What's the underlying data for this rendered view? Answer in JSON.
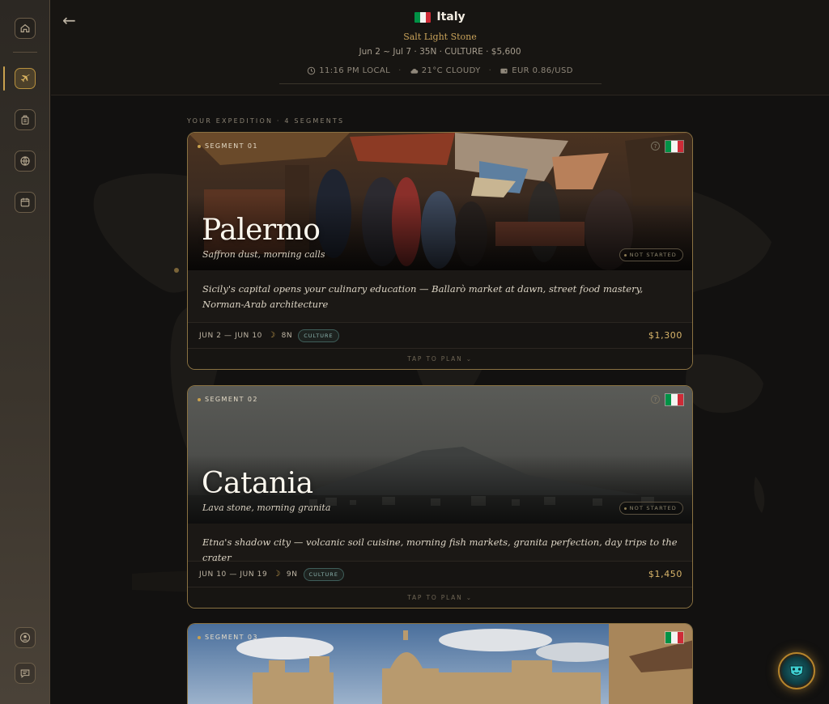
{
  "header": {
    "country": "Italy",
    "subtitle": "Salt Light Stone",
    "meta": "Jun 2 ~ Jul 7 · 35N · CULTURE · $5,600",
    "local_time": "11:16 PM LOCAL",
    "weather": "21°C CLOUDY",
    "currency": "EUR 0.86/USD"
  },
  "sidebar": {
    "items": [
      {
        "icon": "home-icon"
      },
      {
        "icon": "plane-icon",
        "active": true
      },
      {
        "icon": "luggage-icon"
      },
      {
        "icon": "globe-icon"
      },
      {
        "icon": "calendar-icon"
      },
      {
        "icon": "user-icon"
      },
      {
        "icon": "chat-icon"
      }
    ]
  },
  "section_label": "YOUR EXPEDITION · 4 SEGMENTS",
  "segments": [
    {
      "tag": "SEGMENT 01",
      "city": "Palermo",
      "tagline": "Saffron dust, morning calls",
      "status": "NOT STARTED",
      "description": "Sicily's capital opens your culinary education — Ballarò market at dawn, street food mastery, Norman-Arab architecture",
      "dates": "JUN 2 — JUN 10",
      "nights": "8N",
      "category": "CULTURE",
      "price": "$1,300",
      "cta": "TAP TO PLAN ⌄"
    },
    {
      "tag": "SEGMENT 02",
      "city": "Catania",
      "tagline": "Lava stone, morning granita",
      "status": "NOT STARTED",
      "description": "Etna's shadow city — volcanic soil cuisine, morning fish markets, granita perfection, day trips to the crater",
      "dates": "JUN 10 — JUN 19",
      "nights": "9N",
      "category": "CULTURE",
      "price": "$1,450",
      "cta": "TAP TO PLAN ⌄"
    },
    {
      "tag": "SEGMENT 03"
    }
  ],
  "colors": {
    "accent": "#c9a14e",
    "background": "#121110",
    "sidebar": "#3a342c",
    "culture_badge": "#8bb3ae"
  }
}
